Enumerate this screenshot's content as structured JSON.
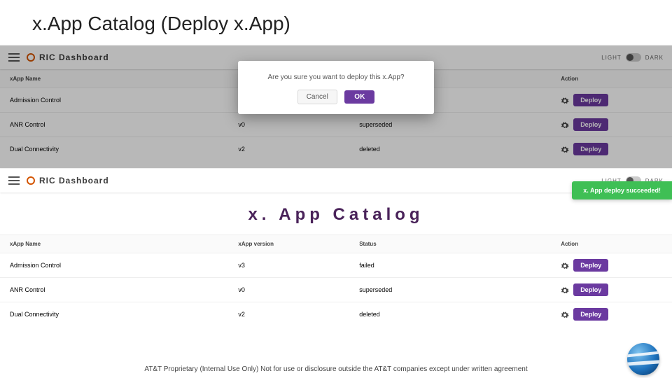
{
  "slide": {
    "title": "x.App Catalog (Deploy x.App)"
  },
  "brand": "RIC Dashboard",
  "theme": {
    "light": "LIGHT",
    "dark": "DARK"
  },
  "page_title": "x. App Catalog",
  "columns": {
    "name": "xApp Name",
    "version": "xApp version",
    "status": "Status",
    "action": "Action"
  },
  "rows": [
    {
      "name": "Admission Control",
      "version": "v3",
      "status": "failed",
      "action": "Deploy"
    },
    {
      "name": "ANR Control",
      "version": "v0",
      "status": "superseded",
      "action": "Deploy"
    },
    {
      "name": "Dual Connectivity",
      "version": "v2",
      "status": "deleted",
      "action": "Deploy"
    }
  ],
  "modal": {
    "message": "Are you sure you want to deploy this x.App?",
    "cancel": "Cancel",
    "ok": "OK"
  },
  "toast": "x. App deploy succeeded!",
  "footer": "AT&T Proprietary (Internal Use Only) Not for use or disclosure outside the AT&T companies except under written agreement"
}
